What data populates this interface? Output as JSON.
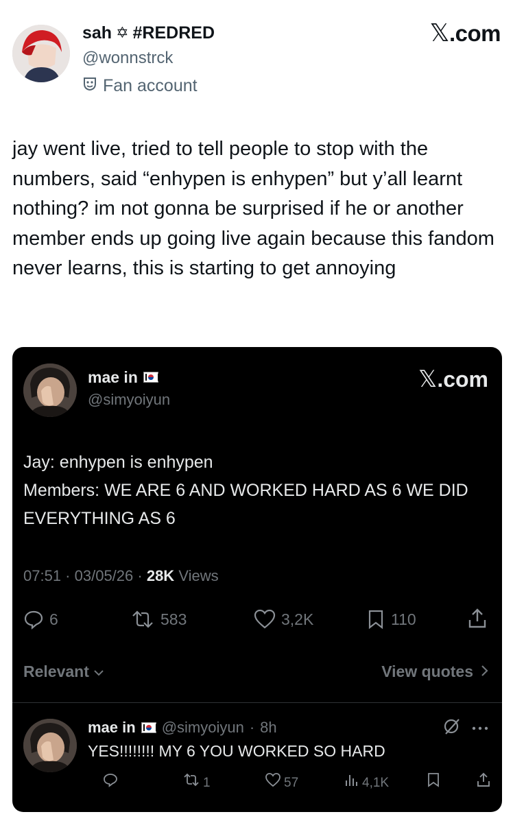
{
  "outer": {
    "display_name": "sah",
    "name_symbol": "✡",
    "name_tag": "#REDRED",
    "handle": "@wonnstrck",
    "label_icon": "mask-icon",
    "label": "Fan account",
    "brand": "X.com",
    "brand_glyph": "𝕏",
    "brand_suffix": ".com",
    "tweet_text": "jay went live, tried to tell people to stop with the numbers, said “enhypen is enhypen” but y’all learnt nothing? im not gonna be surprised if he or another member ends up going live again because this fandom never learns, this is starting to get annoying"
  },
  "quoted": {
    "display_name": "mae in",
    "flag_icon": "south-korea-flag-icon",
    "handle": "@simyoiyun",
    "brand_glyph": "𝕏",
    "brand_suffix": ".com",
    "text_line1": "Jay: enhypen is enhypen",
    "text_line2": "Members: WE ARE 6 AND WORKED HARD AS 6 WE DID EVERYTHING AS 6",
    "time": "07:51",
    "date": "03/05/26",
    "views_count": "28K",
    "views_label": "Views",
    "actions": {
      "replies": "6",
      "reposts": "583",
      "likes": "3,2K",
      "bookmarks": "110"
    },
    "sort_label": "Relevant",
    "view_quotes_label": "View quotes"
  },
  "reply": {
    "display_name": "mae in",
    "handle": "@simyoiyun",
    "time": "8h",
    "text": "YES!!!!!!!! MY 6 YOU WORKED SO HARD",
    "actions": {
      "reposts": "1",
      "likes": "57",
      "views": "4,1K"
    }
  },
  "colors": {
    "dark_bg": "#000000",
    "dark_text": "#e7e9ea",
    "dark_muted": "#71767b",
    "light_muted": "#536471"
  }
}
